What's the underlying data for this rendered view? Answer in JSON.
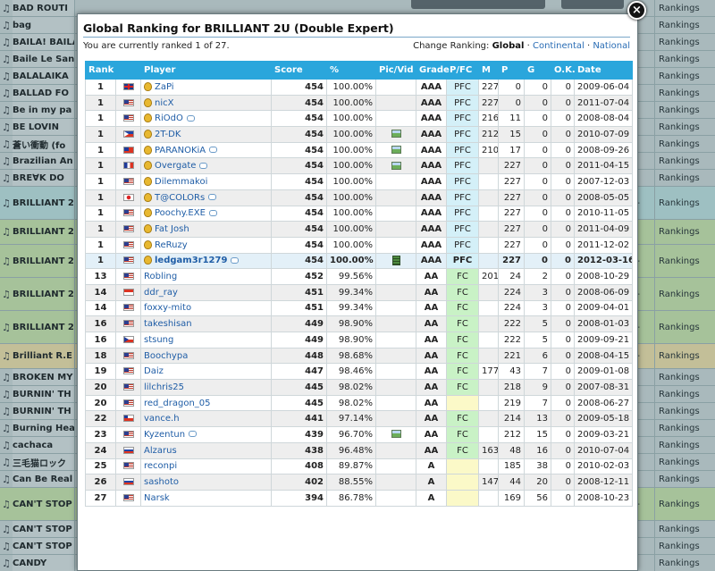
{
  "background": {
    "topbars": true,
    "rows": [
      {
        "title": "BAD ROUTI",
        "right": "",
        "rank": "Rankings",
        "h": 19,
        "hl": ""
      },
      {
        "title": "bag",
        "right": "",
        "rank": "Rankings",
        "h": 19,
        "hl": ""
      },
      {
        "title": "BAILA! BAILA",
        "right": "",
        "rank": "Rankings",
        "h": 19,
        "hl": ""
      },
      {
        "title": "Baile Le Sans",
        "right": "",
        "rank": "Rankings",
        "h": 19,
        "hl": ""
      },
      {
        "title": "BALALAIKA",
        "right": "",
        "rank": "Rankings",
        "h": 19,
        "hl": ""
      },
      {
        "title": "BALLAD FO",
        "right": "",
        "rank": "Rankings",
        "h": 19,
        "hl": ""
      },
      {
        "title": "Be in my pa",
        "right": "",
        "rank": "Rankings",
        "h": 19,
        "hl": ""
      },
      {
        "title": "BE LOVIN",
        "right": "",
        "rank": "Rankings",
        "h": 19,
        "hl": ""
      },
      {
        "title": "蒼い衝動 (fo",
        "right": "",
        "rank": "Rankings",
        "h": 19,
        "hl": ""
      },
      {
        "title": "Brazilian An",
        "right": "",
        "rank": "Rankings",
        "h": 19,
        "hl": ""
      },
      {
        "title": "BRE∀K DO",
        "right": "",
        "rank": "Rankings",
        "h": 19,
        "hl": ""
      },
      {
        "title": "BRILLIANT 2",
        "right": "3-",
        "rank": "Rankings",
        "h": 37,
        "hl": "blue"
      },
      {
        "title": "BRILLIANT 2",
        "right": "",
        "rank": "Rankings",
        "h": 28,
        "hl": "green"
      },
      {
        "title": "BRILLIANT 2",
        "right": "3-",
        "rank": "Rankings",
        "h": 37,
        "hl": "green"
      },
      {
        "title": "BRILLIANT 2",
        "right": "3-",
        "rank": "Rankings",
        "h": 37,
        "hl": "green"
      },
      {
        "title": "BRILLIANT 2",
        "right": "3-",
        "rank": "Rankings",
        "h": 37,
        "hl": "green"
      },
      {
        "title": "Brilliant R.E",
        "right": "5-",
        "rank": "Rankings",
        "h": 28,
        "hl": "yellow"
      },
      {
        "title": "BROKEN MY",
        "right": "",
        "rank": "Rankings",
        "h": 19,
        "hl": ""
      },
      {
        "title": "BURNIN' TH",
        "right": "",
        "rank": "Rankings",
        "h": 19,
        "hl": ""
      },
      {
        "title": "BURNIN' TH",
        "right": "",
        "rank": "Rankings",
        "h": 19,
        "hl": ""
      },
      {
        "title": "Burning Hea",
        "right": "",
        "rank": "Rankings",
        "h": 19,
        "hl": ""
      },
      {
        "title": "cachaca",
        "right": "",
        "rank": "Rankings",
        "h": 19,
        "hl": ""
      },
      {
        "title": "三毛猫ロック",
        "right": "",
        "rank": "Rankings",
        "h": 19,
        "hl": ""
      },
      {
        "title": "Can Be Real",
        "right": "",
        "rank": "Rankings",
        "h": 19,
        "hl": ""
      },
      {
        "title": "CAN'T STOP",
        "right": "2-",
        "rank": "Rankings",
        "h": 37,
        "hl": "green"
      },
      {
        "title": "CAN'T STOP",
        "right": "",
        "rank": "Rankings",
        "h": 19,
        "hl": ""
      },
      {
        "title": "CAN'T STOP",
        "right": "",
        "rank": "Rankings",
        "h": 19,
        "hl": ""
      },
      {
        "title": "CANDY",
        "right": "",
        "rank": "Rankings",
        "h": 19,
        "hl": ""
      }
    ]
  },
  "modal": {
    "title": "Global Ranking for BRILLIANT 2U (Double Expert)",
    "rank_info": "You are currently ranked 1 of 27.",
    "change_ranking_label": "Change Ranking:",
    "change_ranking_options": [
      "Global",
      "Continental",
      "National"
    ],
    "close_label": "×"
  },
  "table": {
    "headers": [
      "Rank",
      "",
      "Player",
      "Score",
      "%",
      "Pic/Vid",
      "Grade",
      "P/FC",
      "M",
      "P",
      "G",
      "O.K.",
      "Date"
    ],
    "rows": [
      {
        "rank": "1",
        "flag": "gb",
        "medal": true,
        "player": "ZaPi",
        "bubble": false,
        "score": "454",
        "pct": "100.00%",
        "pic": "",
        "grade": "AAA",
        "pfc": "PFC",
        "m": "227",
        "p": "0",
        "g": "0",
        "ok": "0",
        "date": "2009-06-04",
        "me": false
      },
      {
        "rank": "1",
        "flag": "us",
        "medal": true,
        "player": "nicX",
        "bubble": false,
        "score": "454",
        "pct": "100.00%",
        "pic": "",
        "grade": "AAA",
        "pfc": "PFC",
        "m": "227",
        "p": "0",
        "g": "0",
        "ok": "0",
        "date": "2011-07-04",
        "me": false
      },
      {
        "rank": "1",
        "flag": "us",
        "medal": true,
        "player": "RiOdO",
        "bubble": true,
        "score": "454",
        "pct": "100.00%",
        "pic": "",
        "grade": "AAA",
        "pfc": "PFC",
        "m": "216",
        "p": "11",
        "g": "0",
        "ok": "0",
        "date": "2008-08-04",
        "me": false
      },
      {
        "rank": "1",
        "flag": "ph",
        "medal": true,
        "player": "2T-DK",
        "bubble": false,
        "score": "454",
        "pct": "100.00%",
        "pic": "pic",
        "grade": "AAA",
        "pfc": "PFC",
        "m": "212",
        "p": "15",
        "g": "0",
        "ok": "0",
        "date": "2010-07-09",
        "me": false
      },
      {
        "rank": "1",
        "flag": "tw",
        "medal": true,
        "player": "PARANOKiA",
        "bubble": true,
        "score": "454",
        "pct": "100.00%",
        "pic": "pic",
        "grade": "AAA",
        "pfc": "PFC",
        "m": "210",
        "p": "17",
        "g": "0",
        "ok": "0",
        "date": "2008-09-26",
        "me": false
      },
      {
        "rank": "1",
        "flag": "fr",
        "medal": true,
        "player": "Overgate",
        "bubble": true,
        "score": "454",
        "pct": "100.00%",
        "pic": "pic",
        "grade": "AAA",
        "pfc": "PFC",
        "m": "",
        "p": "227",
        "g": "0",
        "ok": "0",
        "date": "2011-04-15",
        "me": false
      },
      {
        "rank": "1",
        "flag": "us",
        "medal": true,
        "player": "Dilemmakoi",
        "bubble": false,
        "score": "454",
        "pct": "100.00%",
        "pic": "",
        "grade": "AAA",
        "pfc": "PFC",
        "m": "",
        "p": "227",
        "g": "0",
        "ok": "0",
        "date": "2007-12-03",
        "me": false
      },
      {
        "rank": "1",
        "flag": "jp",
        "medal": true,
        "player": "T@COLORs",
        "bubble": true,
        "score": "454",
        "pct": "100.00%",
        "pic": "",
        "grade": "AAA",
        "pfc": "PFC",
        "m": "",
        "p": "227",
        "g": "0",
        "ok": "0",
        "date": "2008-05-05",
        "me": false
      },
      {
        "rank": "1",
        "flag": "us",
        "medal": true,
        "player": "Poochy.EXE",
        "bubble": true,
        "score": "454",
        "pct": "100.00%",
        "pic": "",
        "grade": "AAA",
        "pfc": "PFC",
        "m": "",
        "p": "227",
        "g": "0",
        "ok": "0",
        "date": "2010-11-05",
        "me": false
      },
      {
        "rank": "1",
        "flag": "us",
        "medal": true,
        "player": "Fat Josh",
        "bubble": false,
        "score": "454",
        "pct": "100.00%",
        "pic": "",
        "grade": "AAA",
        "pfc": "PFC",
        "m": "",
        "p": "227",
        "g": "0",
        "ok": "0",
        "date": "2011-04-09",
        "me": false
      },
      {
        "rank": "1",
        "flag": "us",
        "medal": true,
        "player": "ReRuzy",
        "bubble": false,
        "score": "454",
        "pct": "100.00%",
        "pic": "",
        "grade": "AAA",
        "pfc": "PFC",
        "m": "",
        "p": "227",
        "g": "0",
        "ok": "0",
        "date": "2011-12-02",
        "me": false
      },
      {
        "rank": "1",
        "flag": "us",
        "medal": true,
        "player": "ledgam3r1279",
        "bubble": true,
        "score": "454",
        "pct": "100.00%",
        "pic": "vid",
        "grade": "AAA",
        "pfc": "PFC",
        "m": "",
        "p": "227",
        "g": "0",
        "ok": "0",
        "date": "2012-03-16",
        "me": true
      },
      {
        "rank": "13",
        "flag": "us",
        "medal": false,
        "player": "Robling",
        "bubble": false,
        "score": "452",
        "pct": "99.56%",
        "pic": "",
        "grade": "AA",
        "pfc": "FC",
        "m": "201",
        "p": "24",
        "g": "2",
        "ok": "0",
        "date": "2008-10-29",
        "me": false
      },
      {
        "rank": "14",
        "flag": "sg",
        "medal": false,
        "player": "ddr_ray",
        "bubble": false,
        "score": "451",
        "pct": "99.34%",
        "pic": "",
        "grade": "AA",
        "pfc": "FC",
        "m": "",
        "p": "224",
        "g": "3",
        "ok": "0",
        "date": "2008-06-09",
        "me": false
      },
      {
        "rank": "14",
        "flag": "us",
        "medal": false,
        "player": "foxxy-mito",
        "bubble": false,
        "score": "451",
        "pct": "99.34%",
        "pic": "",
        "grade": "AA",
        "pfc": "FC",
        "m": "",
        "p": "224",
        "g": "3",
        "ok": "0",
        "date": "2009-04-01",
        "me": false
      },
      {
        "rank": "16",
        "flag": "us",
        "medal": false,
        "player": "takeshisan",
        "bubble": false,
        "score": "449",
        "pct": "98.90%",
        "pic": "",
        "grade": "AA",
        "pfc": "FC",
        "m": "",
        "p": "222",
        "g": "5",
        "ok": "0",
        "date": "2008-01-03",
        "me": false
      },
      {
        "rank": "16",
        "flag": "cz",
        "medal": false,
        "player": "stsung",
        "bubble": false,
        "score": "449",
        "pct": "98.90%",
        "pic": "",
        "grade": "AA",
        "pfc": "FC",
        "m": "",
        "p": "222",
        "g": "5",
        "ok": "0",
        "date": "2009-09-21",
        "me": false
      },
      {
        "rank": "18",
        "flag": "us",
        "medal": false,
        "player": "Boochypa",
        "bubble": false,
        "score": "448",
        "pct": "98.68%",
        "pic": "",
        "grade": "AA",
        "pfc": "FC",
        "m": "",
        "p": "221",
        "g": "6",
        "ok": "0",
        "date": "2008-04-15",
        "me": false
      },
      {
        "rank": "19",
        "flag": "us",
        "medal": false,
        "player": "Daiz",
        "bubble": false,
        "score": "447",
        "pct": "98.46%",
        "pic": "",
        "grade": "AA",
        "pfc": "FC",
        "m": "177",
        "p": "43",
        "g": "7",
        "ok": "0",
        "date": "2009-01-08",
        "me": false
      },
      {
        "rank": "20",
        "flag": "us",
        "medal": false,
        "player": "lilchris25",
        "bubble": false,
        "score": "445",
        "pct": "98.02%",
        "pic": "",
        "grade": "AA",
        "pfc": "FC",
        "m": "",
        "p": "218",
        "g": "9",
        "ok": "0",
        "date": "2007-08-31",
        "me": false
      },
      {
        "rank": "20",
        "flag": "us",
        "medal": false,
        "player": "red_dragon_05",
        "bubble": false,
        "score": "445",
        "pct": "98.02%",
        "pic": "",
        "grade": "AA",
        "pfc": "",
        "m": "",
        "p": "219",
        "g": "7",
        "ok": "0",
        "date": "2008-06-27",
        "me": false
      },
      {
        "rank": "22",
        "flag": "cl",
        "medal": false,
        "player": "vance.h",
        "bubble": false,
        "score": "441",
        "pct": "97.14%",
        "pic": "",
        "grade": "AA",
        "pfc": "FC",
        "m": "",
        "p": "214",
        "g": "13",
        "ok": "0",
        "date": "2009-05-18",
        "me": false
      },
      {
        "rank": "23",
        "flag": "us",
        "medal": false,
        "player": "Kyzentun",
        "bubble": true,
        "score": "439",
        "pct": "96.70%",
        "pic": "pic",
        "grade": "AA",
        "pfc": "FC",
        "m": "",
        "p": "212",
        "g": "15",
        "ok": "0",
        "date": "2009-03-21",
        "me": false
      },
      {
        "rank": "24",
        "flag": "ru",
        "medal": false,
        "player": "Alzarus",
        "bubble": false,
        "score": "438",
        "pct": "96.48%",
        "pic": "",
        "grade": "AA",
        "pfc": "FC",
        "m": "163",
        "p": "48",
        "g": "16",
        "ok": "0",
        "date": "2010-07-04",
        "me": false
      },
      {
        "rank": "25",
        "flag": "us",
        "medal": false,
        "player": "reconpi",
        "bubble": false,
        "score": "408",
        "pct": "89.87%",
        "pic": "",
        "grade": "A",
        "pfc": "",
        "m": "",
        "p": "185",
        "g": "38",
        "ok": "0",
        "date": "2010-02-03",
        "me": false
      },
      {
        "rank": "26",
        "flag": "ru",
        "medal": false,
        "player": "sashoto",
        "bubble": false,
        "score": "402",
        "pct": "88.55%",
        "pic": "",
        "grade": "A",
        "pfc": "",
        "m": "147",
        "p": "44",
        "g": "20",
        "ok": "0",
        "date": "2008-12-11",
        "me": false
      },
      {
        "rank": "27",
        "flag": "us",
        "medal": false,
        "player": "Narsk",
        "bubble": false,
        "score": "394",
        "pct": "86.78%",
        "pic": "",
        "grade": "A",
        "pfc": "",
        "m": "",
        "p": "169",
        "g": "56",
        "ok": "0",
        "date": "2008-10-23",
        "me": false
      }
    ]
  },
  "colors": {
    "header": "#2aa6dc",
    "pfc": "#d4f0f8",
    "fc": "#c9f2c6",
    "none": "#fbf9c8",
    "link": "#2a6db5"
  },
  "icons": {
    "flag": "country-flag-icon",
    "medal": "gold-medal-icon",
    "bubble": "comment-bubble-icon",
    "pic": "picture-icon",
    "vid": "video-icon",
    "close": "close-icon",
    "note": "music-note-icon"
  }
}
